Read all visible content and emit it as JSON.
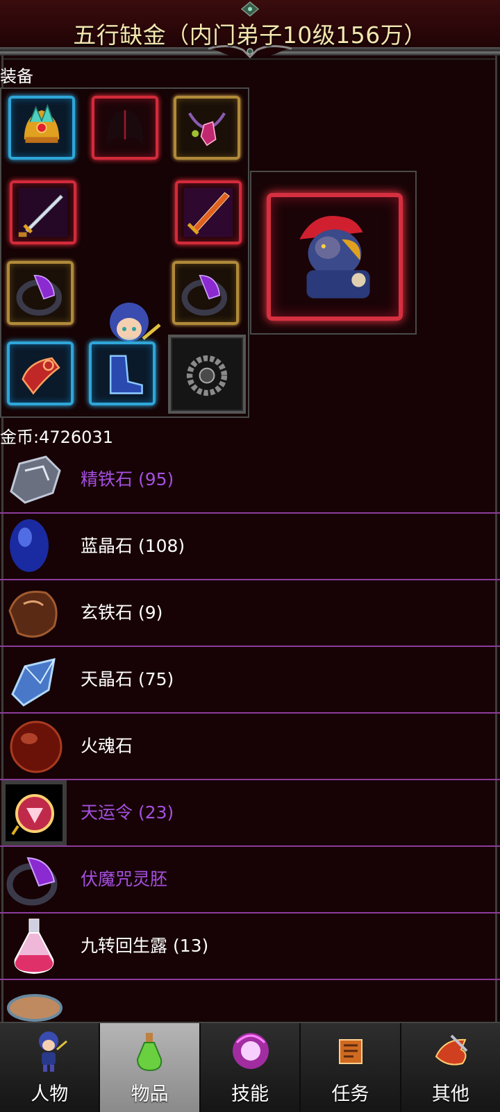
{
  "header": {
    "title": "五行缺金（内门弟子10级156万）"
  },
  "equipment": {
    "section_label": "装备",
    "slots": [
      {
        "name": "helmet",
        "quality": "blue"
      },
      {
        "name": "wings",
        "quality": "red"
      },
      {
        "name": "necklace",
        "quality": "gold"
      },
      {
        "name": "sword-left",
        "quality": "red"
      },
      {
        "name": "sword-right",
        "quality": "red"
      },
      {
        "name": "ring-left",
        "quality": "gold"
      },
      {
        "name": "ring-right",
        "quality": "gold"
      },
      {
        "name": "bracer",
        "quality": "blue"
      },
      {
        "name": "boots",
        "quality": "blue"
      },
      {
        "name": "bead-charm",
        "quality": "gray"
      }
    ],
    "pet": {
      "name": "demon-pet",
      "quality": "red"
    }
  },
  "gold": {
    "label": "金币:4726031"
  },
  "items": [
    {
      "name": "精铁石 (95)",
      "color": "purple",
      "icon": "iron-ore-icon"
    },
    {
      "name": "蓝晶石 (108)",
      "color": "white",
      "icon": "blue-crystal-icon"
    },
    {
      "name": "玄铁石 (9)",
      "color": "white",
      "icon": "dark-iron-icon"
    },
    {
      "name": "天晶石 (75)",
      "color": "white",
      "icon": "sky-crystal-icon"
    },
    {
      "name": "火魂石",
      "color": "white",
      "icon": "fire-soul-stone-icon"
    },
    {
      "name": "天运令 (23)",
      "color": "purple",
      "icon": "fortune-token-icon"
    },
    {
      "name": "伏魔咒灵胚",
      "color": "purple",
      "icon": "demon-seal-ring-icon"
    },
    {
      "name": "九转回生露 (13)",
      "color": "white",
      "icon": "revival-potion-icon"
    },
    {
      "name": "",
      "color": "white",
      "icon": "soup-bowl-icon"
    }
  ],
  "nav": {
    "tabs": [
      {
        "label": "人物",
        "icon": "character-icon",
        "active": false
      },
      {
        "label": "物品",
        "icon": "potion-icon",
        "active": true
      },
      {
        "label": "技能",
        "icon": "skill-orb-icon",
        "active": false
      },
      {
        "label": "任务",
        "icon": "quest-flag-icon",
        "active": false
      },
      {
        "label": "其他",
        "icon": "dragon-icon",
        "active": false
      }
    ]
  },
  "colors": {
    "purple_text": "#a44fe0",
    "row_divider": "#8d3b9c",
    "title_gold": "#f4e6b0",
    "background": "#170305"
  }
}
